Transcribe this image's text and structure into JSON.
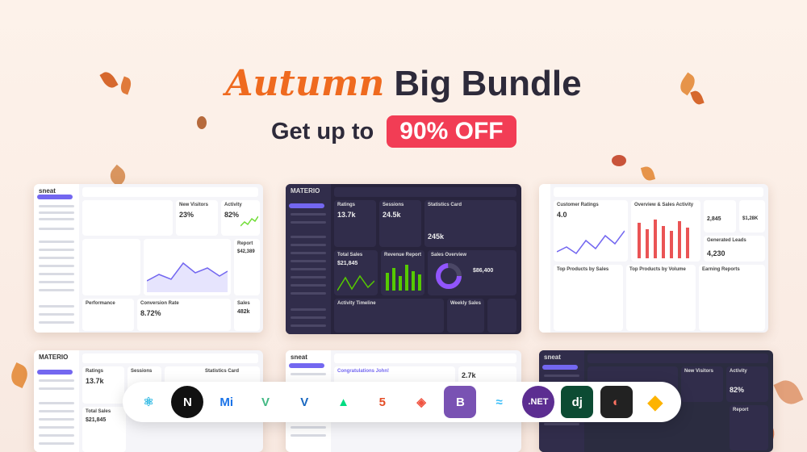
{
  "hero": {
    "title_script": "Autumn",
    "title_main": "Big Bundle",
    "subtitle": "Get up to",
    "discount": "90% OFF"
  },
  "cards": {
    "c1": {
      "brand": "sneat",
      "t1": "New Visitors",
      "v1": "23%",
      "t2": "Activity",
      "v2": "82%",
      "t3": "Performance",
      "t4": "Conversion Rate",
      "v4": "8.72%",
      "t5": "Report",
      "v5": "$42,389",
      "t6": "Sales",
      "v6": "482k"
    },
    "c2": {
      "brand": "MATERIO",
      "t1": "Ratings",
      "v1": "13.7k",
      "t2": "Sessions",
      "v2": "24.5k",
      "t3": "Statistics Card",
      "v3": "245k",
      "t4": "Total Sales",
      "v4": "$21,845",
      "t5": "Revenue Report",
      "t6": "Sales Overview",
      "v6": "$86,400",
      "t7": "Activity Timeline",
      "t8": "Weekly Sales"
    },
    "c3": {
      "t1": "Customer Ratings",
      "v1": "4.0",
      "t2": "Overview & Sales Activity",
      "t3": "Generated Leads",
      "v3": "4,230",
      "t4": "Top Products by Sales",
      "t5": "Top Products by Volume",
      "t6": "Earning Reports",
      "v7": "2,845",
      "v8": "$1,28K"
    },
    "c4": {
      "brand": "MATERIO",
      "t1": "Ratings",
      "v1": "13.7k",
      "t2": "Sessions",
      "t3": "Statistics Card",
      "t4": "Total Sales",
      "v4": "$21,845"
    },
    "c5": {
      "brand": "sneat",
      "t1": "Congratulations John!",
      "v2": "2.7k"
    },
    "c6": {
      "brand": "sneat",
      "t1": "New Visitors",
      "t2": "Activity",
      "v2": "82%",
      "t3": "Report"
    }
  },
  "tech_icons": [
    {
      "name": "react-icon",
      "label": "⚛",
      "color": "#35bbe4"
    },
    {
      "name": "nextjs-icon",
      "label": "N",
      "color": "#111111"
    },
    {
      "name": "mui-icon",
      "label": "Mi",
      "color": "#1a73e8"
    },
    {
      "name": "vue-icon",
      "label": "V",
      "color": "#41b883"
    },
    {
      "name": "vuetify-icon",
      "label": "V",
      "color": "#1867c0"
    },
    {
      "name": "nuxt-icon",
      "label": "▲",
      "color": "#00dc82"
    },
    {
      "name": "html5-icon",
      "label": "5",
      "color": "#e44d26"
    },
    {
      "name": "laravel-icon",
      "label": "◈",
      "color": "#f05340"
    },
    {
      "name": "bootstrap-icon",
      "label": "B",
      "color": "#7952b3"
    },
    {
      "name": "tailwind-icon",
      "label": "≈",
      "color": "#38bdf8"
    },
    {
      "name": "dotnet-icon",
      "label": ".NET",
      "color": "#5c2d91"
    },
    {
      "name": "django-icon",
      "label": "dj",
      "color": "#0c4b33"
    },
    {
      "name": "figma-icon",
      "label": "◐",
      "color": "#f24e1e"
    },
    {
      "name": "sketch-icon",
      "label": "◆",
      "color": "#fdb300"
    }
  ]
}
